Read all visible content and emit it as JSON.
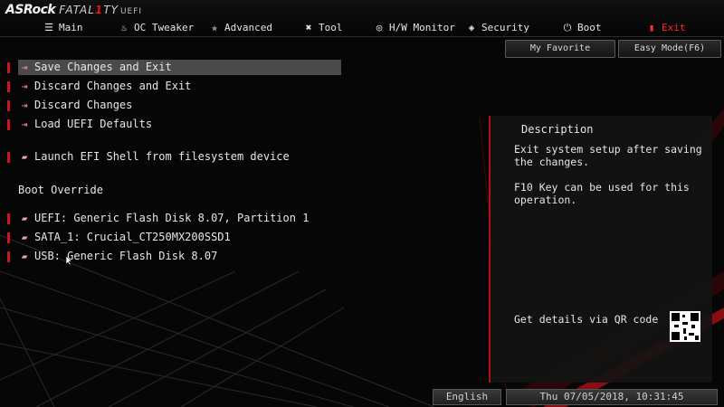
{
  "logo": {
    "brand": "ASRock",
    "fatal_pre": "FATAL",
    "fatal_t": "1",
    "fatal_post": "TY",
    "uefi": "UEFI"
  },
  "tabs": [
    {
      "label": "Main",
      "icon": "list-icon"
    },
    {
      "label": "OC Tweaker",
      "icon": "flame-icon"
    },
    {
      "label": "Advanced",
      "icon": "star-icon"
    },
    {
      "label": "Tool",
      "icon": "tools-icon"
    },
    {
      "label": "H/W Monitor",
      "icon": "monitor-icon"
    },
    {
      "label": "Security",
      "icon": "shield-icon"
    },
    {
      "label": "Boot",
      "icon": "power-icon"
    },
    {
      "label": "Exit",
      "icon": "exit-icon"
    }
  ],
  "active_tab": "Exit",
  "buttons": {
    "favorite": "My Favorite",
    "easy_mode": "Easy Mode(F6)"
  },
  "menu": {
    "items": [
      {
        "label": "Save Changes and Exit"
      },
      {
        "label": "Discard Changes and Exit"
      },
      {
        "label": "Discard Changes"
      },
      {
        "label": "Load UEFI Defaults"
      },
      {
        "label": "Launch EFI Shell from filesystem device"
      }
    ],
    "section_label": "Boot Override",
    "boot_items": [
      {
        "label": "UEFI: Generic Flash Disk 8.07, Partition 1"
      },
      {
        "label": "SATA_1: Crucial_CT250MX200SSD1"
      },
      {
        "label": "USB: Generic Flash Disk 8.07"
      }
    ]
  },
  "description": {
    "title": "Description",
    "text": "Exit system setup after saving the changes.\n\nF10 Key can be used for this operation.",
    "qr_label": "Get details via QR code"
  },
  "footer": {
    "language": "English",
    "datetime": "Thu 07/05/2018, 10:31:45"
  },
  "colors": {
    "accent": "#d0141e",
    "selected_bg": "#4a4a4a",
    "panel_bg": "#141414"
  }
}
